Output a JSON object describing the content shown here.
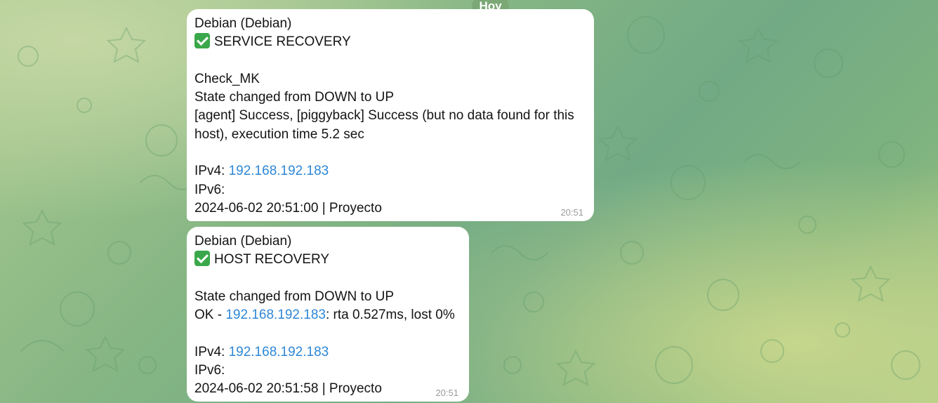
{
  "date_label": "Hoy",
  "messages": [
    {
      "header": "Debian (Debian)",
      "title": "SERVICE RECOVERY",
      "service": "Check_MK",
      "state": "State changed from DOWN to UP",
      "output": "[agent] Success, [piggyback] Success (but no data found for this host), execution time 5.2 sec",
      "ipv4_label": "IPv4: ",
      "ipv4": "192.168.192.183",
      "ipv6_label": "IPv6:",
      "footer": "2024-06-02 20:51:00 | Proyecto",
      "time": "20:51"
    },
    {
      "header": "Debian (Debian)",
      "title": "HOST RECOVERY",
      "state": "State changed from DOWN to UP",
      "output_prefix": "OK - ",
      "output_ip": "192.168.192.183",
      "output_suffix": ": rta 0.527ms, lost 0%",
      "ipv4_label": "IPv4: ",
      "ipv4": "192.168.192.183",
      "ipv6_label": "IPv6:",
      "footer": "2024-06-02 20:51:58 | Proyecto",
      "time": "20:51"
    }
  ],
  "icons": {
    "status_check": "white-heavy-check-mark-icon",
    "background": "telegram-doodle-pattern"
  },
  "colors": {
    "link": "#2e87d6",
    "date_pill": "#7ba875",
    "bubble": "#ffffff",
    "check": "#3aa84a"
  }
}
